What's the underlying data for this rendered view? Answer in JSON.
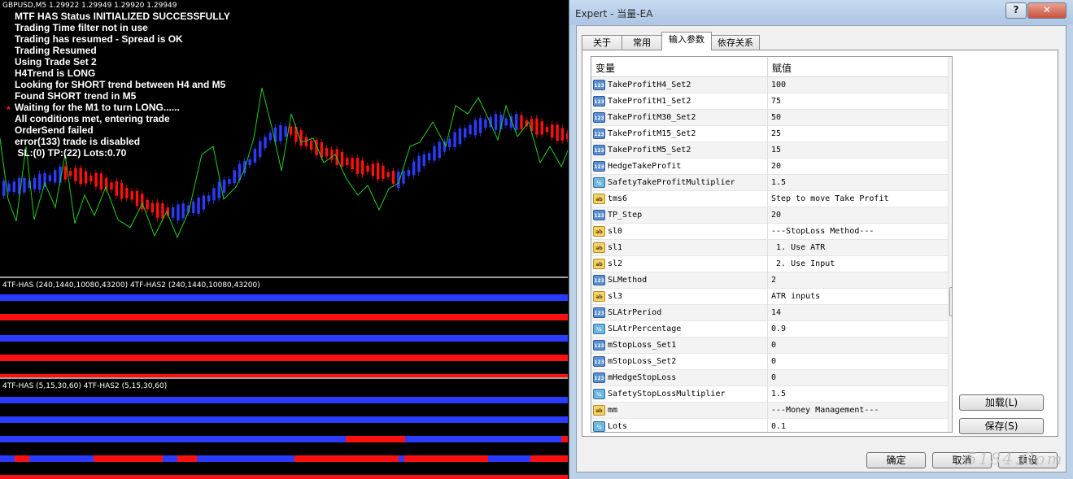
{
  "chart": {
    "symbol_line": "GBPUSD,M5  1.29922 1.29949 1.29920 1.29949",
    "log": [
      "MTF HAS Status INITIALIZED SUCCESSFULLY",
      "Trading Time filter not in use",
      "Trading has resumed - Spread is OK",
      "Trading Resumed",
      "Using Trade Set 2",
      "H4Trend is LONG",
      "Looking for SHORT trend between H4 and M5",
      "Found SHORT trend in M5",
      "Waiting for the M1 to turn LONG......",
      "All conditions met, entering trade",
      "OrderSend failed",
      "error(133) trade is disabled",
      " SL:(0) TP:(22) Lots:0.70"
    ],
    "star": "*",
    "indicator1_label": "4TF-HAS (240,1440,10080,43200)  4TF-HAS2 (240,1440,10080,43200)",
    "indicator2_label": "4TF-HAS (5,15,30,60)  4TF-HAS2 (5,15,30,60)",
    "colors": {
      "up": "#2b3bff",
      "down": "#ff1010",
      "line": "#20d020",
      "background": "#000000"
    }
  },
  "dialog": {
    "title": "Expert - 当量-EA",
    "help_glyph": "?",
    "close_glyph": "✕",
    "tabs": [
      {
        "label": "关于"
      },
      {
        "label": "常用"
      },
      {
        "label": "输入参数",
        "active": true
      },
      {
        "label": "依存关系"
      }
    ],
    "columns": {
      "name": "变量",
      "value": "赋值"
    },
    "rows": [
      {
        "type": "int",
        "icon": "123",
        "name": "TakeProfitH4_Set2",
        "value": "100"
      },
      {
        "type": "int",
        "icon": "123",
        "name": "TakeProfitH1_Set2",
        "value": "75"
      },
      {
        "type": "int",
        "icon": "123",
        "name": "TakeProfitM30_Set2",
        "value": "50"
      },
      {
        "type": "int",
        "icon": "123",
        "name": "TakeProfitM15_Set2",
        "value": "25"
      },
      {
        "type": "int",
        "icon": "123",
        "name": "TakeProfitM5_Set2",
        "value": "15"
      },
      {
        "type": "int",
        "icon": "123",
        "name": "HedgeTakeProfit",
        "value": "20"
      },
      {
        "type": "dbl",
        "icon": "½",
        "name": "SafetyTakeProfitMultiplier",
        "value": "1.5"
      },
      {
        "type": "str",
        "icon": "ab",
        "name": "tms6",
        "value": "Step to move Take Profit"
      },
      {
        "type": "int",
        "icon": "123",
        "name": "TP_Step",
        "value": "20"
      },
      {
        "type": "str",
        "icon": "ab",
        "name": "sl0",
        "value": "---StopLoss Method---"
      },
      {
        "type": "str",
        "icon": "ab",
        "name": "sl1",
        "value": " 1. Use ATR"
      },
      {
        "type": "str",
        "icon": "ab",
        "name": "sl2",
        "value": " 2. Use Input"
      },
      {
        "type": "int",
        "icon": "123",
        "name": "SLMethod",
        "value": "2"
      },
      {
        "type": "str",
        "icon": "ab",
        "name": "sl3",
        "value": "ATR inputs"
      },
      {
        "type": "int",
        "icon": "123",
        "name": "SLAtrPeriod",
        "value": "14"
      },
      {
        "type": "dbl",
        "icon": "½",
        "name": "SLAtrPercentage",
        "value": "0.9"
      },
      {
        "type": "int",
        "icon": "123",
        "name": "mStopLoss_Set1",
        "value": "0"
      },
      {
        "type": "int",
        "icon": "123",
        "name": "mStopLoss_Set2",
        "value": "0"
      },
      {
        "type": "int",
        "icon": "123",
        "name": "mHedgeStopLoss",
        "value": "0"
      },
      {
        "type": "dbl",
        "icon": "½",
        "name": "SafetyStopLossMultiplier",
        "value": "1.5"
      },
      {
        "type": "str",
        "icon": "ab",
        "name": "mm",
        "value": "---Money Management---"
      },
      {
        "type": "dbl",
        "icon": "½",
        "name": "Lots",
        "value": "0.1"
      }
    ],
    "load_button": "加载(L)",
    "save_button": "保存(S)",
    "ok_button": "确定",
    "cancel_button": "取消",
    "reset_button": "重设",
    "watermark": "5184.Com"
  }
}
